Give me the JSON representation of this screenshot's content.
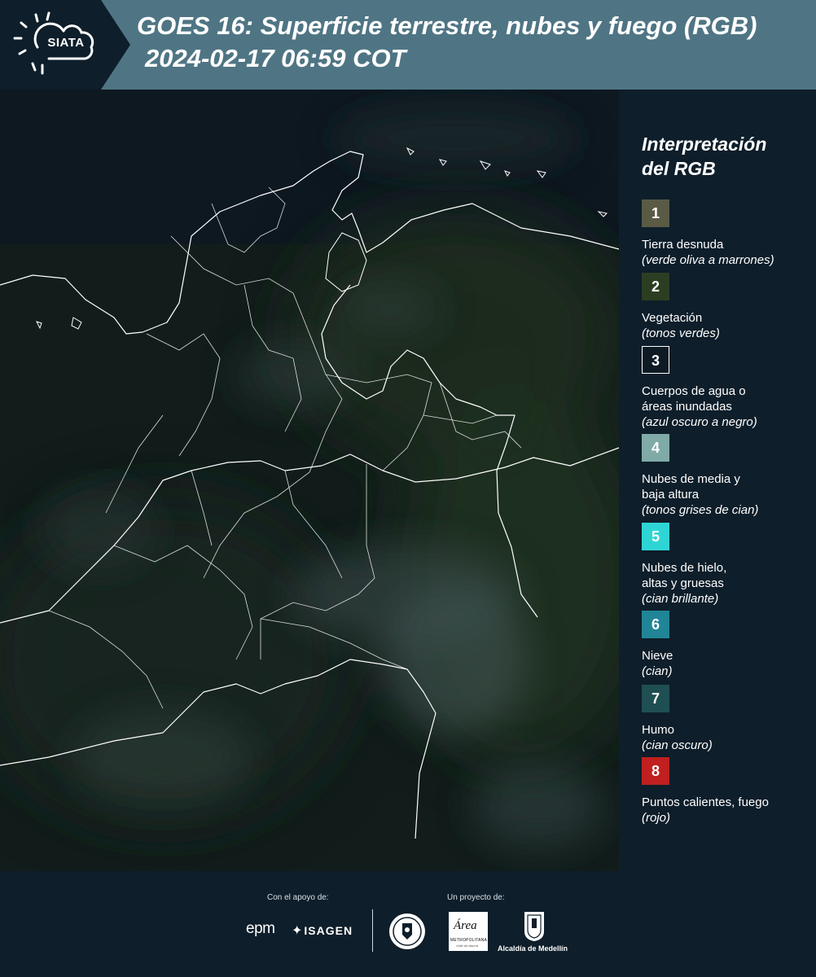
{
  "header": {
    "logo_text": "SIATA",
    "title_line1": "GOES 16: Superficie terrestre, nubes y fuego (RGB)",
    "title_line2": "2024-02-17 06:59 COT"
  },
  "legend": {
    "title_line1": "Interpretación",
    "title_line2": "del RGB",
    "items": [
      {
        "number": "1",
        "color": "#5a5a45",
        "label_lines": [
          "Tierra desnuda"
        ],
        "note": "(verde oliva a marrones)"
      },
      {
        "number": "2",
        "color": "#2c3e22",
        "label_lines": [
          "Vegetación"
        ],
        "note": "(tonos verdes)"
      },
      {
        "number": "3",
        "color": "#0d1a24",
        "label_lines": [
          "Cuerpos de agua o",
          "áreas inundadas"
        ],
        "note": "(azul oscuro a negro)"
      },
      {
        "number": "4",
        "color": "#7faaa8",
        "label_lines": [
          "Nubes de media y",
          "baja altura"
        ],
        "note": "(tonos grises de cian)"
      },
      {
        "number": "5",
        "color": "#2fd5d5",
        "label_lines": [
          "Nubes de hielo,",
          "altas y gruesas"
        ],
        "note": "(cian brillante)"
      },
      {
        "number": "6",
        "color": "#1f8597",
        "label_lines": [
          "Nieve"
        ],
        "note": "(cian)"
      },
      {
        "number": "7",
        "color": "#1f4f52",
        "label_lines": [
          "Humo"
        ],
        "note": "(cian oscuro)"
      },
      {
        "number": "8",
        "color": "#c0201f",
        "label_lines": [
          "Puntos calientes, fuego"
        ],
        "note": "(rojo)"
      }
    ]
  },
  "footer": {
    "support_label": "Con el apoyo de:",
    "project_label": "Un proyecto de:",
    "sponsor_epm": "epm",
    "sponsor_isagen": "ISAGEN",
    "partner_area_main": "Área",
    "partner_area_sub": "METROPOLITANA",
    "partner_area_small": "Valle de Aburrá",
    "partner_alcaldia": "Alcaldía de Medellín"
  },
  "colors": {
    "header_bg": "#4f7584",
    "logo_panel_bg": "#0e1e2a",
    "page_bg": "#0e1e2a",
    "boundary_line": "#ffffff"
  },
  "icons": [
    "sun-cloud-logo-icon",
    "isagen-mark-icon",
    "seal-icon",
    "shield-icon"
  ]
}
